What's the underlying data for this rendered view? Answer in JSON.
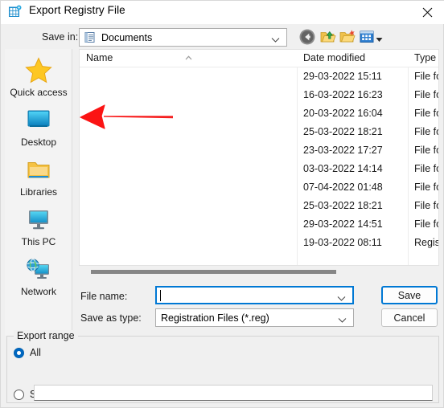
{
  "window": {
    "title": "Export Registry File",
    "icon": "registry-editor-icon",
    "close_label": "✕"
  },
  "toolbar": {
    "save_in_label": "Save in:",
    "save_in_value": "Documents",
    "save_in_icon": "documents-folder-icon",
    "buttons": [
      {
        "name": "back-button",
        "icon": "back-arrow-icon"
      },
      {
        "name": "up-one-level-button",
        "icon": "up-folder-icon"
      },
      {
        "name": "new-folder-button",
        "icon": "new-folder-icon"
      },
      {
        "name": "views-button",
        "icon": "views-grid-icon"
      }
    ]
  },
  "places_bar": {
    "items": [
      {
        "label": "Quick access",
        "icon": "star-icon"
      },
      {
        "label": "Desktop",
        "icon": "desktop-icon"
      },
      {
        "label": "Libraries",
        "icon": "folder-icon"
      },
      {
        "label": "This PC",
        "icon": "monitor-icon"
      },
      {
        "label": "Network",
        "icon": "globe-network-icon"
      }
    ]
  },
  "file_list": {
    "columns": [
      "Name",
      "Date modified",
      "Type"
    ],
    "sort_indicator": "ascending",
    "rows": [
      {
        "name": "",
        "date_modified": "29-03-2022 15:11",
        "type": "File fo"
      },
      {
        "name": "",
        "date_modified": "16-03-2022 16:23",
        "type": "File fo"
      },
      {
        "name": "",
        "date_modified": "20-03-2022 16:04",
        "type": "File fo"
      },
      {
        "name": "",
        "date_modified": "25-03-2022 18:21",
        "type": "File fo"
      },
      {
        "name": "",
        "date_modified": "23-03-2022 17:27",
        "type": "File fo"
      },
      {
        "name": "",
        "date_modified": "03-03-2022 14:14",
        "type": "File fo"
      },
      {
        "name": "",
        "date_modified": "07-04-2022 01:48",
        "type": "File fo"
      },
      {
        "name": "",
        "date_modified": "25-03-2022 18:21",
        "type": "File fo"
      },
      {
        "name": "",
        "date_modified": "29-03-2022 14:51",
        "type": "File fo"
      },
      {
        "name": "",
        "date_modified": "19-03-2022 08:11",
        "type": "Regis"
      }
    ]
  },
  "form": {
    "file_name_label": "File name:",
    "file_name_value": "",
    "save_as_type_label": "Save as type:",
    "save_as_type_value": "Registration Files (*.reg)",
    "save_button": "Save",
    "cancel_button": "Cancel"
  },
  "export_range": {
    "legend": "Export range",
    "options": [
      {
        "label": "All",
        "selected": true
      },
      {
        "label": "Selected branch",
        "selected": false
      }
    ],
    "branch_value": ""
  },
  "annotation": {
    "arrow_color": "#f81c1c",
    "points_to": "Desktop"
  },
  "colors": {
    "accent": "#0078d4",
    "radio_selected": "#0067c0",
    "dialog_background": "#f0f0f0",
    "list_background": "#ffffff",
    "arrow_red": "#f81c1c"
  }
}
